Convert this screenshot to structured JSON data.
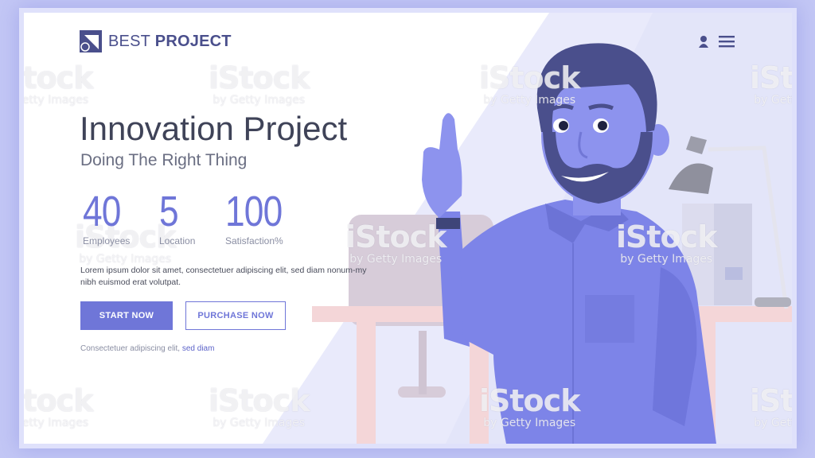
{
  "brand": {
    "word1": "BEST",
    "word2": " PROJECT"
  },
  "icons": {
    "logo": "triangle-square-logo",
    "user": "user-icon",
    "menu": "hamburger-menu-icon"
  },
  "hero": {
    "title": "Innovation Project",
    "subtitle": "Doing The Right Thing"
  },
  "stats": [
    {
      "value": "40",
      "label": "Employees"
    },
    {
      "value": "5",
      "label": "Location"
    },
    {
      "value": "100",
      "label": "Satisfaction%"
    }
  ],
  "description": "Lorem ipsum dolor sit amet, consectetuer adipiscing elit, sed diam nonum-my nibh euismod erat volutpat.",
  "buttons": {
    "primary": "START NOW",
    "secondary": "PURCHASE NOW"
  },
  "footnote": {
    "text": "Consectetuer adipiscing elit, ",
    "link": "sed diam"
  },
  "watermark": {
    "brand": "iStock",
    "byline": "by Getty Images"
  },
  "colors": {
    "accent": "#6f76d8",
    "frame": "#c3c7f5",
    "figure": "#7d84e8",
    "hair": "#4a4f8c",
    "desk": "#f4d6d8"
  }
}
